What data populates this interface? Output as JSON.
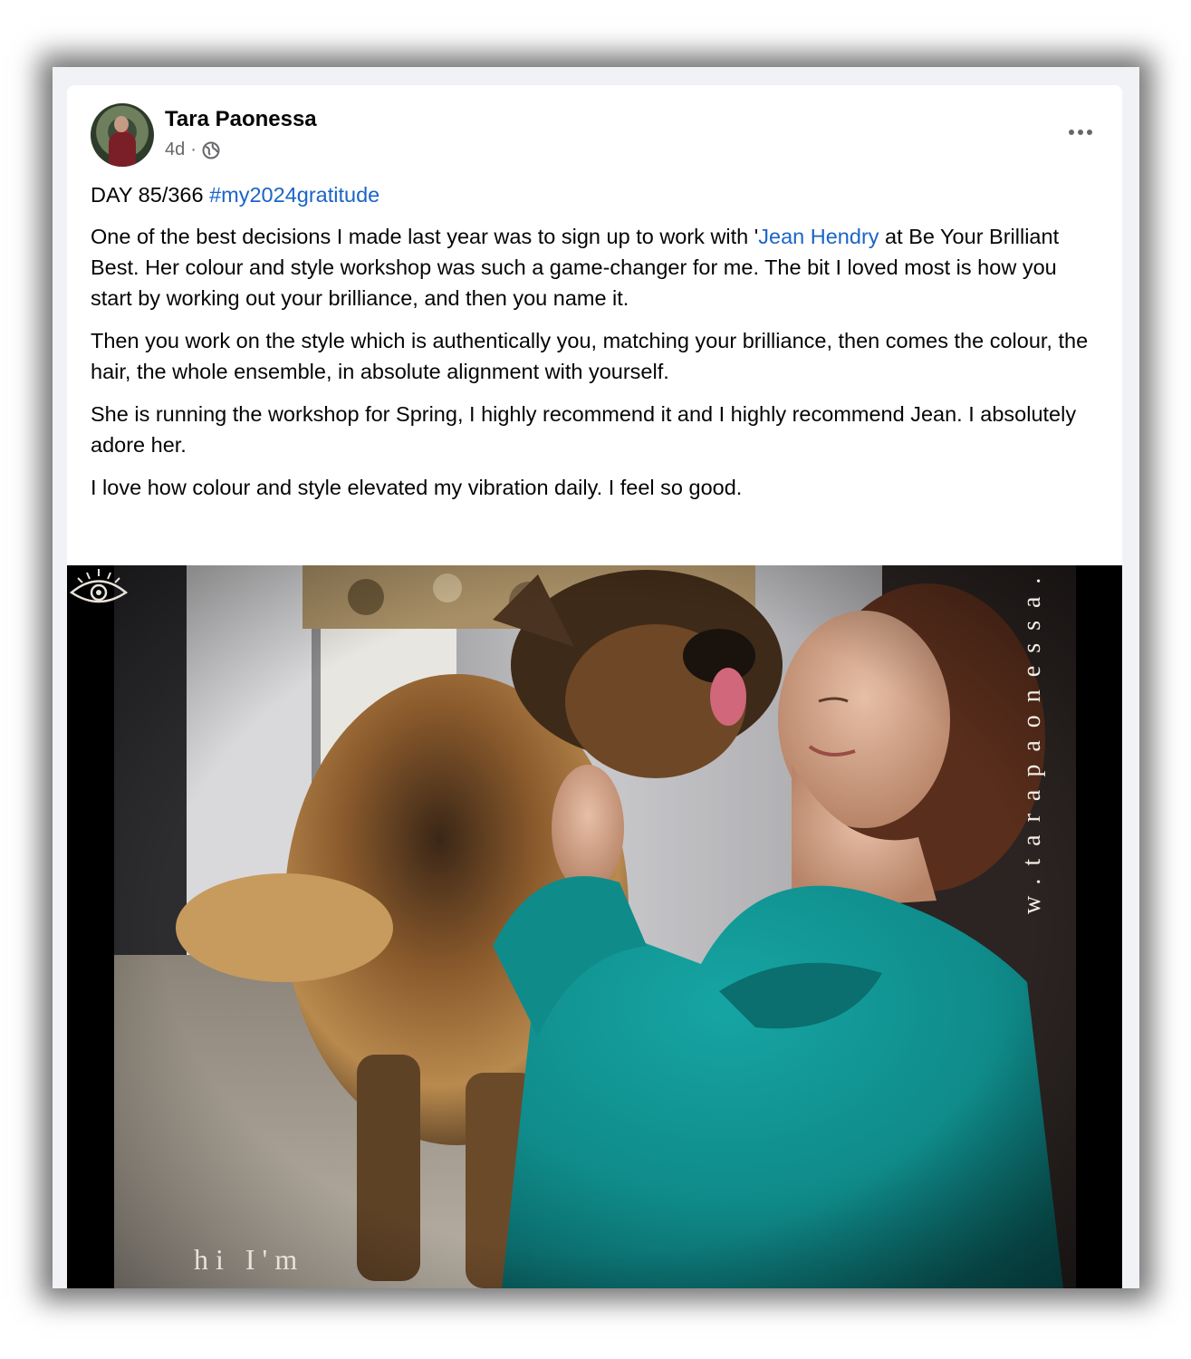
{
  "post": {
    "author": "Tara Paonessa",
    "time": "4d",
    "separator": "·",
    "privacy_icon": "globe-icon",
    "more_icon": "more-horizontal-icon",
    "day_label": "DAY 85/366 ",
    "hashtag": "#my2024gratitude",
    "paragraph1_before": "One of the best decisions I made last year was to sign up to work with '",
    "mention": "Jean Hendry",
    "paragraph1_after": " at Be Your Brilliant Best. Her colour and style workshop was such a game-changer for me. The bit I loved most is how you start by working out your brilliance, and then you name it.",
    "paragraph2": "Then you work on the style which is authentically you, matching your brilliance, then comes the colour, the hair, the whole ensemble, in absolute alignment with yourself.",
    "paragraph3": "She is running the workshop for Spring, I highly recommend it and I highly recommend Jean. I absolutely adore her.",
    "paragraph4": "I love how colour and style elevated my vibration daily. I feel so good."
  },
  "photo": {
    "watermark_vertical": "w.tarapaonessa.com",
    "watermark_bottom": "hi I'm",
    "logo_icon": "eye-logo-icon"
  },
  "colors": {
    "link": "#1b64c8",
    "text": "#050505",
    "secondary": "#65676b",
    "sweater": "#0f8b8a"
  }
}
